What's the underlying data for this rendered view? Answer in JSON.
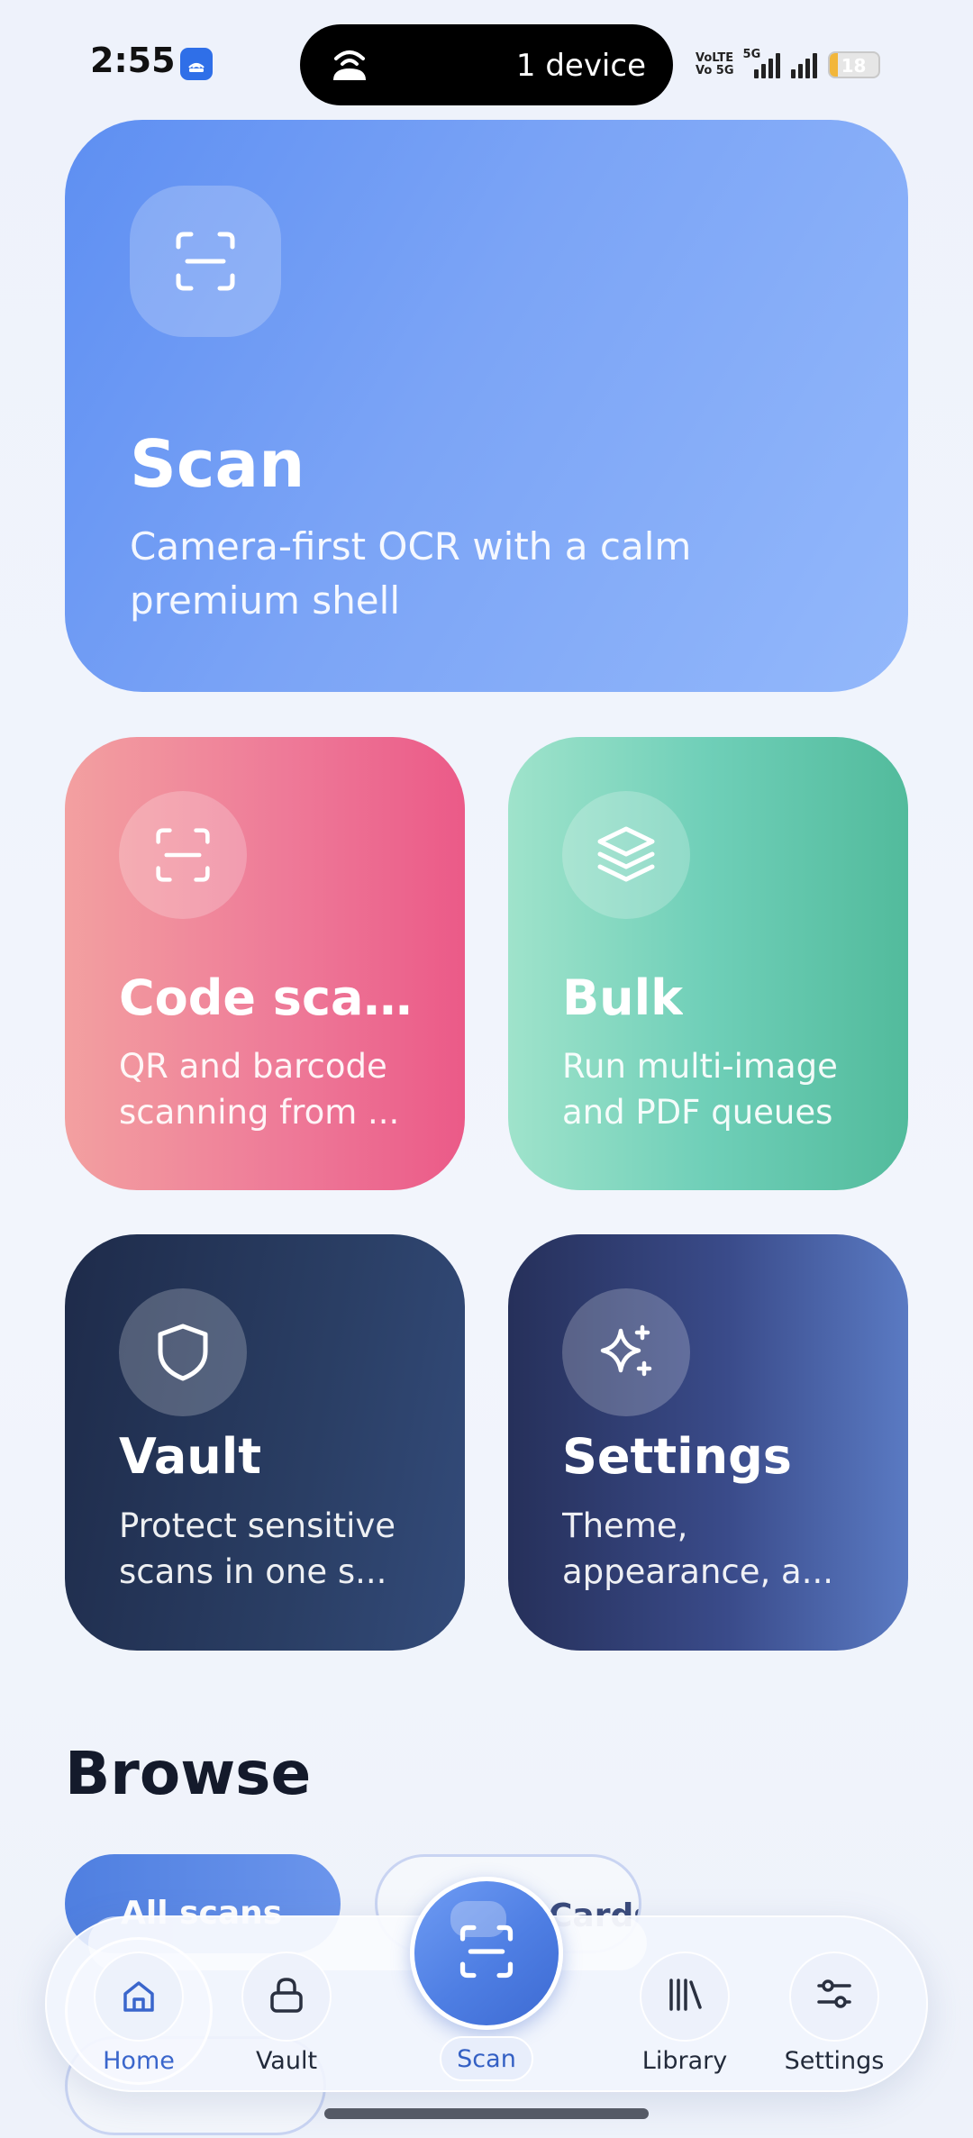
{
  "status_bar": {
    "time": "2:55",
    "island_text": "1 device",
    "volte_line1": "VoLTE",
    "volte_line2": "Vo 5G",
    "network": "5G",
    "battery": "18"
  },
  "cards": {
    "scan": {
      "title": "Scan",
      "subtitle_line1": "Camera-first OCR with a calm",
      "subtitle_line2": "premium shell",
      "icon": "scan-frame-icon"
    },
    "code_scan": {
      "title": "Code scan...",
      "subtitle_line1": "QR and barcode",
      "subtitle_line2": "scanning from ...",
      "icon": "scan-frame-icon"
    },
    "bulk": {
      "title": "Bulk",
      "subtitle_line1": "Run multi-image",
      "subtitle_line2": "and PDF queues",
      "icon": "layers-icon"
    },
    "vault": {
      "title": "Vault",
      "subtitle_line1": "Protect sensitive",
      "subtitle_line2": "scans in one s...",
      "icon": "shield-icon"
    },
    "settings": {
      "title": "Settings",
      "subtitle_line1": "Theme,",
      "subtitle_line2": "appearance, a...",
      "icon": "sparkles-icon"
    }
  },
  "browse": {
    "title": "Browse",
    "chip_active": "All scans",
    "chip_second": "Cards"
  },
  "nav": {
    "home": "Home",
    "vault": "Vault",
    "scan": "Scan",
    "library": "Library",
    "settings": "Settings",
    "active": "home"
  },
  "colors": {
    "accent": "#4e7ee3",
    "scan_card": "#7ba4f6",
    "code_card": "#ee7a98",
    "bulk_card": "#6fcfb8",
    "vault_card": "#2a3e64",
    "settings_card": "#3a4b8a"
  }
}
